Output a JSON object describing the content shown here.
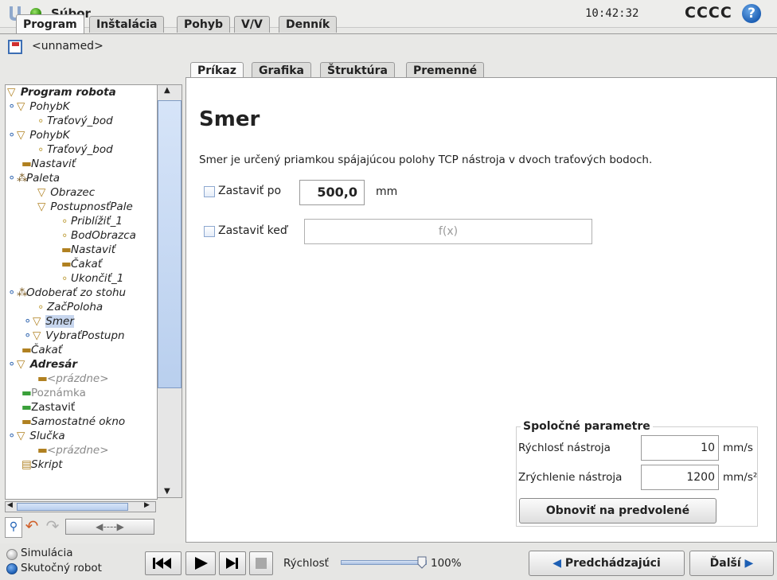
{
  "header": {
    "file_menu": "Súbor",
    "clock": "10:42:32",
    "robot_name": "CCCC",
    "help": "?"
  },
  "main_tabs": [
    "Program",
    "Inštalácia",
    "Pohyb",
    "V/V",
    "Denník"
  ],
  "program_name": "<unnamed>",
  "tree": {
    "items": [
      "Program robota",
      "PohybK",
      "Traťový_bod",
      "PohybK",
      "Traťový_bod",
      "Nastaviť",
      "Paleta",
      "Obrazec",
      "PostupnosťPale",
      "Priblížiť_1",
      "BodObrazca",
      "Nastaviť",
      "Čakať",
      "Ukončiť_1",
      "Odoberať zo stohu",
      "ZačPoloha",
      "Smer",
      "VybraťPostupn",
      "Čakať",
      "Adresár",
      "<prázdne>",
      "Poznámka",
      "Zastaviť",
      "Samostatné okno",
      "Slučka",
      "<prázdne>",
      "Skript"
    ]
  },
  "content_tabs": [
    "Príkaz",
    "Grafika",
    "Štruktúra",
    "Premenné"
  ],
  "page": {
    "title": "Smer",
    "description": "Smer je určený priamkou spájajúcou polohy TCP nástroja v dvoch traťových bodoch.",
    "stop_after_label": "Zastaviť po",
    "stop_after_value": "500,0",
    "stop_after_unit": "mm",
    "stop_when_label": "Zastaviť keď",
    "stop_when_placeholder": "f(x)"
  },
  "common_params": {
    "title": "Spoločné parametre",
    "tool_speed_label": "Rýchlosť nástroja",
    "tool_speed_value": "10",
    "tool_speed_unit": "mm/s",
    "tool_accel_label": "Zrýchlenie nástroja",
    "tool_accel_value": "1200",
    "tool_accel_unit": "mm/s²",
    "reset_button": "Obnoviť na predvolené"
  },
  "footer": {
    "simulation": "Simulácia",
    "real_robot": "Skutočný robot",
    "speed_label": "Rýchlosť",
    "speed_value": "100%",
    "speed_fraction": 1.0,
    "prev_button": "Predchádzajúci",
    "next_button": "Ďalší"
  },
  "colors": {
    "status_green": "#3c9a16",
    "selection": "#c7d6ee",
    "accent_blue": "#1d5fb4"
  }
}
